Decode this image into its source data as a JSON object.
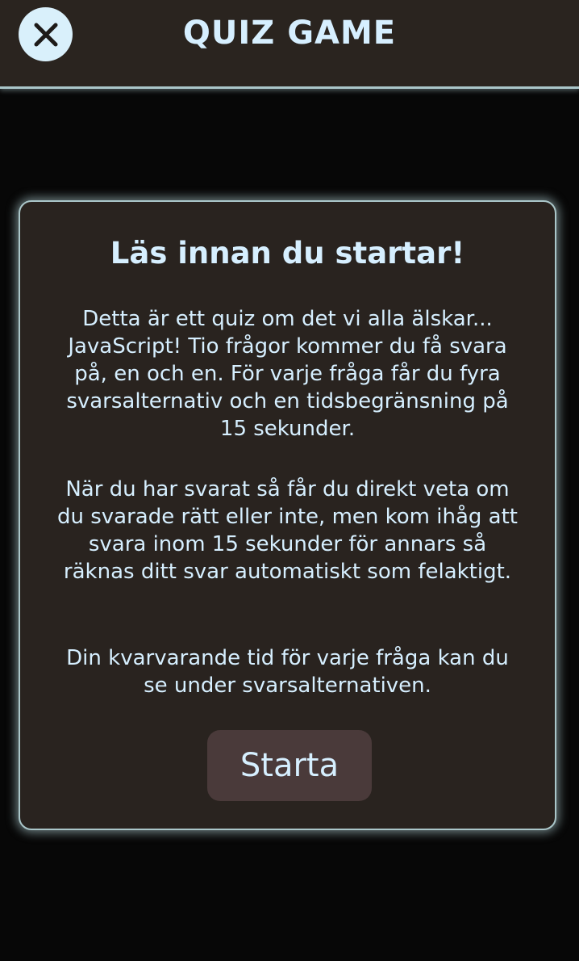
{
  "header": {
    "title": "QUIZ GAME",
    "close_icon": "close-icon"
  },
  "intro": {
    "heading": "Läs innan du startar!",
    "paragraphs": [
      "Detta är ett quiz om det vi alla älskar... JavaScript! Tio frågor kommer du få svara på, en och en. För varje fråga får du fyra svarsalternativ och en tidsbegränsning på 15 sekunder.",
      "När du har svarat så får du direkt veta om du svarade rätt eller inte, men kom ihåg att svara inom 15 sekunder för annars så räknas ditt svar automatiskt som felaktigt.",
      "Din kvarvarande tid för varje fråga kan du se under svarsalternativen."
    ],
    "start_label": "Starta"
  },
  "colors": {
    "background": "#070707",
    "panel": "#29231f",
    "text": "#d6efff",
    "border_glow": "#aac6c9",
    "button": "#4a3a3a",
    "close_button": "#d9f0fb"
  }
}
